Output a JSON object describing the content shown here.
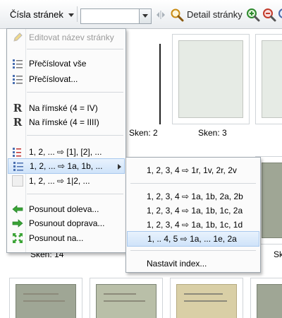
{
  "toolbar": {
    "page_numbers_label": "Čísla stránek",
    "search_value": "",
    "detail_label": "Detail stránky"
  },
  "thumbnails": {
    "labels": [
      "Sken: 2",
      "Sken: 3",
      "Sken: 14",
      "Sk"
    ]
  },
  "menu": {
    "items": [
      {
        "label": "Editovat název stránky",
        "icon": "pencil-icon",
        "enabled": false
      },
      {
        "label": "Přečíslovat vše",
        "icon": "numbered-list-icon"
      },
      {
        "label": "Přečíslovat...",
        "icon": "numbered-list-icon"
      },
      {
        "label": "Na římské (4 = IV)",
        "icon": "roman-numeral-icon"
      },
      {
        "label": "Na římské (4 = IIII)",
        "icon": "roman-numeral-icon"
      },
      {
        "label": "1, 2, ... ⇨ [1], [2], ...",
        "icon": "bracket-numbering-icon"
      },
      {
        "label": "1, 2, ... ⇨ 1a, 1b, ...",
        "icon": "letter-numbering-icon",
        "has_submenu": true,
        "highlighted": true
      },
      {
        "label": "1, 2, ... ⇨ 1|2, ...",
        "icon": "blank-page-icon"
      },
      {
        "label": "Posunout doleva...",
        "icon": "arrow-left-icon"
      },
      {
        "label": "Posunout doprava...",
        "icon": "arrow-right-icon"
      },
      {
        "label": "Posunout na...",
        "icon": "move-to-icon"
      }
    ]
  },
  "submenu": {
    "items": [
      {
        "label": "1, 2, 3, 4 ⇨ 1r, 1v, 2r, 2v"
      },
      {
        "label": "1, 2, 3, 4 ⇨ 1a, 1b, 2a, 2b"
      },
      {
        "label": "1, 2, 3, 4 ⇨ 1a, 1b, 1c, 2a"
      },
      {
        "label": "1, 2, 3, 4 ⇨ 1a, 1b, 1c, 1d"
      },
      {
        "label": "1, .. 4, 5 ⇨ 1a, ... 1e, 2a",
        "highlighted": true
      },
      {
        "label": "Nastavit index..."
      }
    ]
  },
  "colors": {
    "highlight": "#cfe3f9",
    "menu_background": "#fbfbfb",
    "arrow_green": "#3aa335"
  }
}
